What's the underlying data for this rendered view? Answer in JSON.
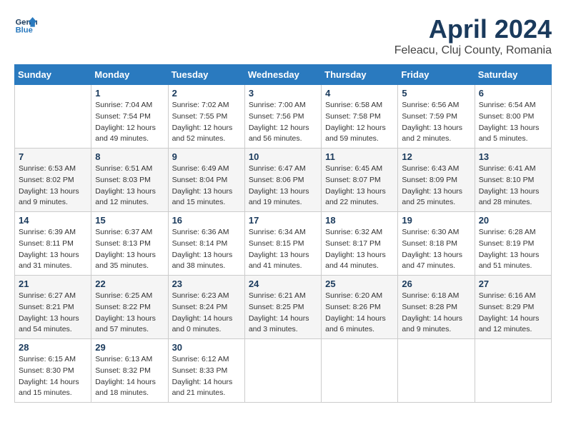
{
  "logo": {
    "line1": "General",
    "line2": "Blue"
  },
  "title": "April 2024",
  "subtitle": "Feleacu, Cluj County, Romania",
  "weekdays": [
    "Sunday",
    "Monday",
    "Tuesday",
    "Wednesday",
    "Thursday",
    "Friday",
    "Saturday"
  ],
  "weeks": [
    [
      {
        "day": "",
        "info": ""
      },
      {
        "day": "1",
        "info": "Sunrise: 7:04 AM\nSunset: 7:54 PM\nDaylight: 12 hours\nand 49 minutes."
      },
      {
        "day": "2",
        "info": "Sunrise: 7:02 AM\nSunset: 7:55 PM\nDaylight: 12 hours\nand 52 minutes."
      },
      {
        "day": "3",
        "info": "Sunrise: 7:00 AM\nSunset: 7:56 PM\nDaylight: 12 hours\nand 56 minutes."
      },
      {
        "day": "4",
        "info": "Sunrise: 6:58 AM\nSunset: 7:58 PM\nDaylight: 12 hours\nand 59 minutes."
      },
      {
        "day": "5",
        "info": "Sunrise: 6:56 AM\nSunset: 7:59 PM\nDaylight: 13 hours\nand 2 minutes."
      },
      {
        "day": "6",
        "info": "Sunrise: 6:54 AM\nSunset: 8:00 PM\nDaylight: 13 hours\nand 5 minutes."
      }
    ],
    [
      {
        "day": "7",
        "info": "Sunrise: 6:53 AM\nSunset: 8:02 PM\nDaylight: 13 hours\nand 9 minutes."
      },
      {
        "day": "8",
        "info": "Sunrise: 6:51 AM\nSunset: 8:03 PM\nDaylight: 13 hours\nand 12 minutes."
      },
      {
        "day": "9",
        "info": "Sunrise: 6:49 AM\nSunset: 8:04 PM\nDaylight: 13 hours\nand 15 minutes."
      },
      {
        "day": "10",
        "info": "Sunrise: 6:47 AM\nSunset: 8:06 PM\nDaylight: 13 hours\nand 19 minutes."
      },
      {
        "day": "11",
        "info": "Sunrise: 6:45 AM\nSunset: 8:07 PM\nDaylight: 13 hours\nand 22 minutes."
      },
      {
        "day": "12",
        "info": "Sunrise: 6:43 AM\nSunset: 8:09 PM\nDaylight: 13 hours\nand 25 minutes."
      },
      {
        "day": "13",
        "info": "Sunrise: 6:41 AM\nSunset: 8:10 PM\nDaylight: 13 hours\nand 28 minutes."
      }
    ],
    [
      {
        "day": "14",
        "info": "Sunrise: 6:39 AM\nSunset: 8:11 PM\nDaylight: 13 hours\nand 31 minutes."
      },
      {
        "day": "15",
        "info": "Sunrise: 6:37 AM\nSunset: 8:13 PM\nDaylight: 13 hours\nand 35 minutes."
      },
      {
        "day": "16",
        "info": "Sunrise: 6:36 AM\nSunset: 8:14 PM\nDaylight: 13 hours\nand 38 minutes."
      },
      {
        "day": "17",
        "info": "Sunrise: 6:34 AM\nSunset: 8:15 PM\nDaylight: 13 hours\nand 41 minutes."
      },
      {
        "day": "18",
        "info": "Sunrise: 6:32 AM\nSunset: 8:17 PM\nDaylight: 13 hours\nand 44 minutes."
      },
      {
        "day": "19",
        "info": "Sunrise: 6:30 AM\nSunset: 8:18 PM\nDaylight: 13 hours\nand 47 minutes."
      },
      {
        "day": "20",
        "info": "Sunrise: 6:28 AM\nSunset: 8:19 PM\nDaylight: 13 hours\nand 51 minutes."
      }
    ],
    [
      {
        "day": "21",
        "info": "Sunrise: 6:27 AM\nSunset: 8:21 PM\nDaylight: 13 hours\nand 54 minutes."
      },
      {
        "day": "22",
        "info": "Sunrise: 6:25 AM\nSunset: 8:22 PM\nDaylight: 13 hours\nand 57 minutes."
      },
      {
        "day": "23",
        "info": "Sunrise: 6:23 AM\nSunset: 8:24 PM\nDaylight: 14 hours\nand 0 minutes."
      },
      {
        "day": "24",
        "info": "Sunrise: 6:21 AM\nSunset: 8:25 PM\nDaylight: 14 hours\nand 3 minutes."
      },
      {
        "day": "25",
        "info": "Sunrise: 6:20 AM\nSunset: 8:26 PM\nDaylight: 14 hours\nand 6 minutes."
      },
      {
        "day": "26",
        "info": "Sunrise: 6:18 AM\nSunset: 8:28 PM\nDaylight: 14 hours\nand 9 minutes."
      },
      {
        "day": "27",
        "info": "Sunrise: 6:16 AM\nSunset: 8:29 PM\nDaylight: 14 hours\nand 12 minutes."
      }
    ],
    [
      {
        "day": "28",
        "info": "Sunrise: 6:15 AM\nSunset: 8:30 PM\nDaylight: 14 hours\nand 15 minutes."
      },
      {
        "day": "29",
        "info": "Sunrise: 6:13 AM\nSunset: 8:32 PM\nDaylight: 14 hours\nand 18 minutes."
      },
      {
        "day": "30",
        "info": "Sunrise: 6:12 AM\nSunset: 8:33 PM\nDaylight: 14 hours\nand 21 minutes."
      },
      {
        "day": "",
        "info": ""
      },
      {
        "day": "",
        "info": ""
      },
      {
        "day": "",
        "info": ""
      },
      {
        "day": "",
        "info": ""
      }
    ]
  ]
}
